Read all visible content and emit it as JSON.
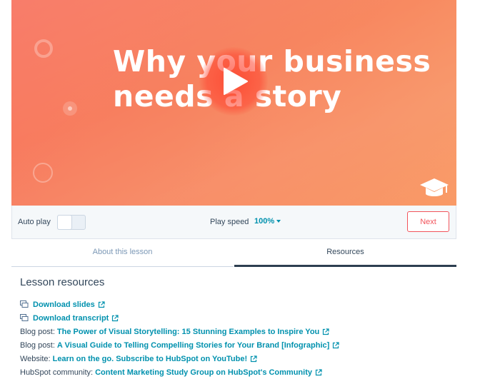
{
  "video": {
    "headline_line1": "Why your business",
    "headline_line2": "needs a story",
    "accent": "#f7835f"
  },
  "controls": {
    "autoplay_label": "Auto play",
    "autoplay_on": false,
    "speed_label": "Play speed",
    "speed_value": "100%",
    "next_label": "Next"
  },
  "tabs": [
    {
      "label": "About this lesson",
      "active": false
    },
    {
      "label": "Resources",
      "active": true
    }
  ],
  "resources": {
    "title": "Lesson resources",
    "items": [
      {
        "prefix": "",
        "link": "Download slides",
        "icon": "download-icon"
      },
      {
        "prefix": "",
        "link": "Download transcript",
        "icon": "download-icon"
      },
      {
        "prefix": "Blog post:",
        "link": "The Power of Visual Storytelling: 15 Stunning Examples to Inspire You"
      },
      {
        "prefix": "Blog post:",
        "link": "A Visual Guide to Telling Compelling Stories for Your Brand [Infographic]"
      },
      {
        "prefix": "Website:",
        "link": "Learn on the go. Subscribe to HubSpot on YouTube!"
      },
      {
        "prefix": "HubSpot community:",
        "link": "Content Marketing Study Group on HubSpot's Community"
      }
    ]
  },
  "colors": {
    "link": "#0091ae",
    "next_button": "#f2545b",
    "text": "#33475b"
  }
}
